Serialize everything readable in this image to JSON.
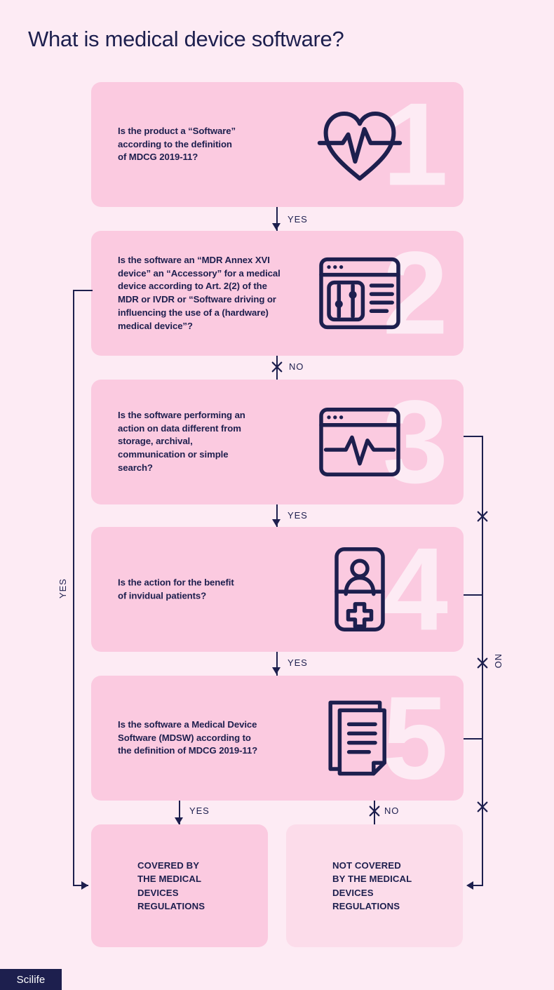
{
  "title": "What is medical device software?",
  "colors": {
    "background": "#fdebf4",
    "card": "#fbcae0",
    "card_soft": "#fcdcea",
    "ink": "#1d1f4e",
    "number_ghost": "#fdebf4"
  },
  "steps": [
    {
      "number": "1",
      "icon": "heart-pulse-icon",
      "question": "Is the product a “Software”\naccording to the definition\nof MDCG 2019-11?"
    },
    {
      "number": "2",
      "icon": "browser-settings-icon",
      "question": "Is the software an “MDR Annex XVI\ndevice” an “Accessory” for a medical\ndevice according to Art. 2(2) of the\nMDR or IVDR or “Software driving or\ninfluencing the use of a (hardware)\nmedical device”?"
    },
    {
      "number": "3",
      "icon": "browser-ecg-icon",
      "question": "Is the software performing an\naction on data different from\nstorage, archival,\ncommunication or simple\nsearch?"
    },
    {
      "number": "4",
      "icon": "patient-card-icon",
      "question": "Is the action for the benefit\nof invidual patients?"
    },
    {
      "number": "5",
      "icon": "documents-icon",
      "question": "Is the software a Medical Device\nSoftware (MDSW) according to\nthe definition of MDCG 2019-11?"
    }
  ],
  "outcomes": {
    "covered": "COVERED BY\nTHE MEDICAL\nDEVICES\nREGULATIONS",
    "not_covered": "NOT COVERED\nBY THE MEDICAL\nDEVICES\nREGULATIONS"
  },
  "edges": {
    "step1_to_step2": "YES",
    "step2_to_step3": "NO",
    "step3_to_step4": "YES",
    "step4_to_step5": "YES",
    "step5_to_covered": "YES",
    "step5_to_not_covered": "NO",
    "left_branch": "YES",
    "right_branch": "NO"
  },
  "logo": {
    "text": "Scilife"
  }
}
